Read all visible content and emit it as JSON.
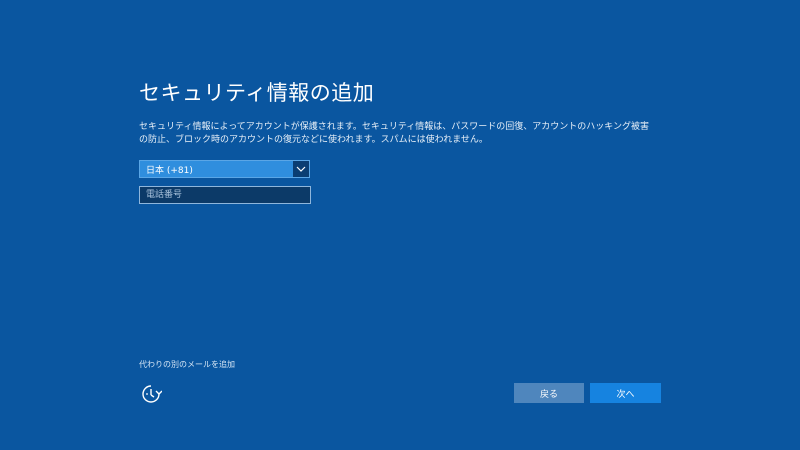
{
  "page": {
    "title": "セキュリティ情報の追加",
    "description_line1": "セキュリティ情報によってアカウントが保護されます。セキュリティ情報は、パスワードの回復、アカウントのハッキング被害",
    "description_line2": "の防止、ブロック時のアカウントの復元などに使われます。スパムには使われません。"
  },
  "form": {
    "country_selected": "日本 (+81)",
    "phone_placeholder": "電話番号",
    "phone_value": ""
  },
  "links": {
    "alternate_email": "代わりの別のメールを追加"
  },
  "buttons": {
    "back_label": "戻る",
    "next_label": "次へ"
  },
  "icons": {
    "accessibility": "ease-of-access-icon",
    "dropdown": "chevron-down-icon"
  },
  "colors": {
    "background": "#0a56a0",
    "select_bg": "#2f8ede",
    "next_button": "#1683e0",
    "back_button": "#4f86bd"
  }
}
